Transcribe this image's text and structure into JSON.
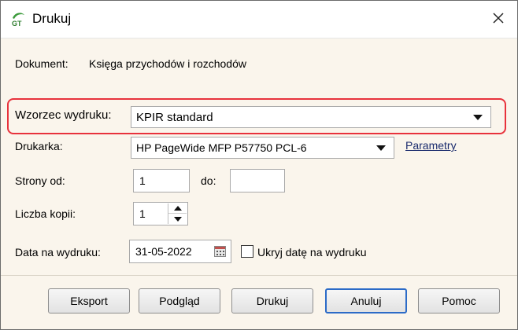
{
  "window": {
    "title": "Drukuj",
    "app_icon": "gt-logo-icon",
    "close_icon": "close-icon"
  },
  "document": {
    "label": "Dokument:",
    "value": "Księga przychodów i rozchodów"
  },
  "template": {
    "label": "Wzorzec wydruku:",
    "value": "KPIR standard",
    "highlight_color": "#e8323c"
  },
  "printer": {
    "label": "Drukarka:",
    "value": "HP PageWide MFP P57750 PCL-6",
    "link": "Parametry"
  },
  "pages": {
    "from_label": "Strony od:",
    "from_value": "1",
    "to_label": "do:",
    "to_value": ""
  },
  "copies": {
    "label": "Liczba kopii:",
    "value": "1"
  },
  "print_date": {
    "label": "Data na wydruku:",
    "value": "31-05-2022",
    "hide_label": "Ukryj datę na wydruku",
    "hide_checked": false
  },
  "buttons": {
    "export": "Eksport",
    "preview": "Podgląd",
    "print": "Drukuj",
    "cancel": "Anuluj",
    "help": "Pomoc"
  },
  "colors": {
    "background": "#faf5ec",
    "link": "#1a2b6d",
    "default_button_border": "#2c6bc7"
  }
}
